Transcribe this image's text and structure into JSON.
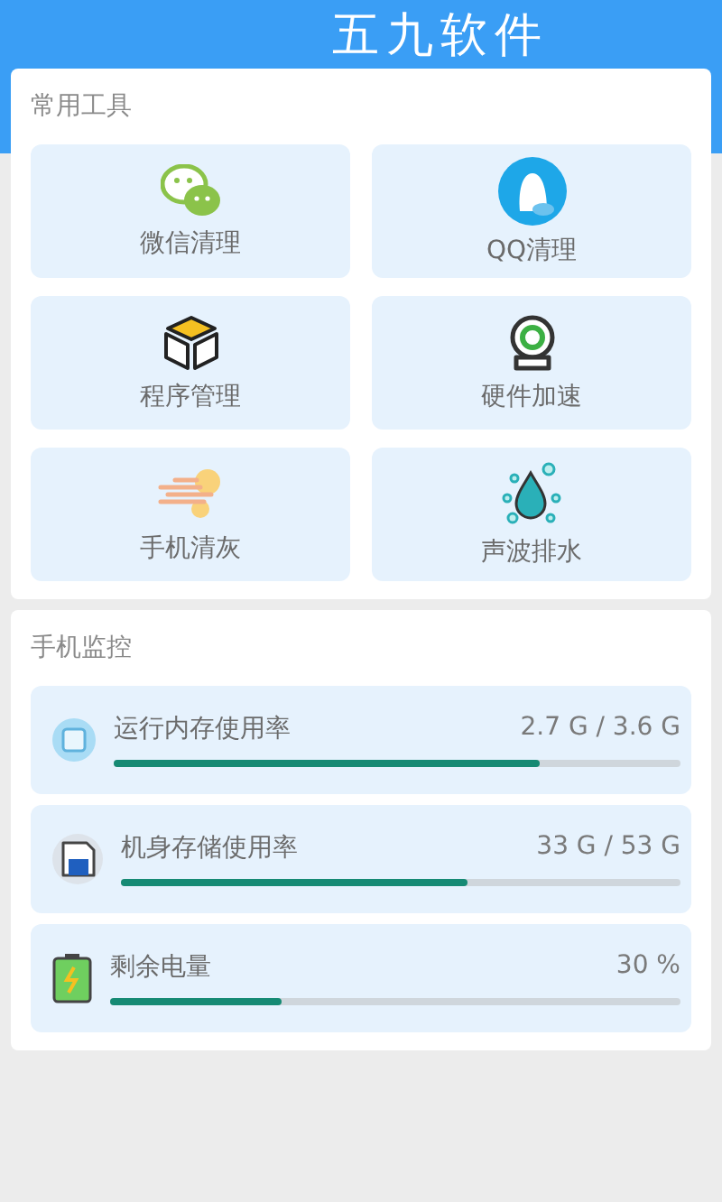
{
  "header": {
    "title": "五九软件"
  },
  "tools": {
    "title": "常用工具",
    "items": [
      {
        "kind": "chat",
        "label": "微信清理"
      },
      {
        "kind": "penguin",
        "label": "QQ清理"
      },
      {
        "kind": "box",
        "label": "程序管理"
      },
      {
        "kind": "camera",
        "label": "硬件加速"
      },
      {
        "kind": "wind",
        "label": "手机清灰"
      },
      {
        "kind": "drop",
        "label": "声波排水"
      }
    ]
  },
  "monitor": {
    "title": "手机监控",
    "items": [
      {
        "kind": "chip",
        "label": "运行内存使用率",
        "reading": "2.7 G / 3.6 G",
        "level": 0.75
      },
      {
        "kind": "disk",
        "label": "机身存储使用率",
        "reading": "33 G / 53 G",
        "level": 0.62
      },
      {
        "kind": "battery",
        "label": "剩余电量",
        "reading": "30 %",
        "level": 0.3
      }
    ]
  }
}
